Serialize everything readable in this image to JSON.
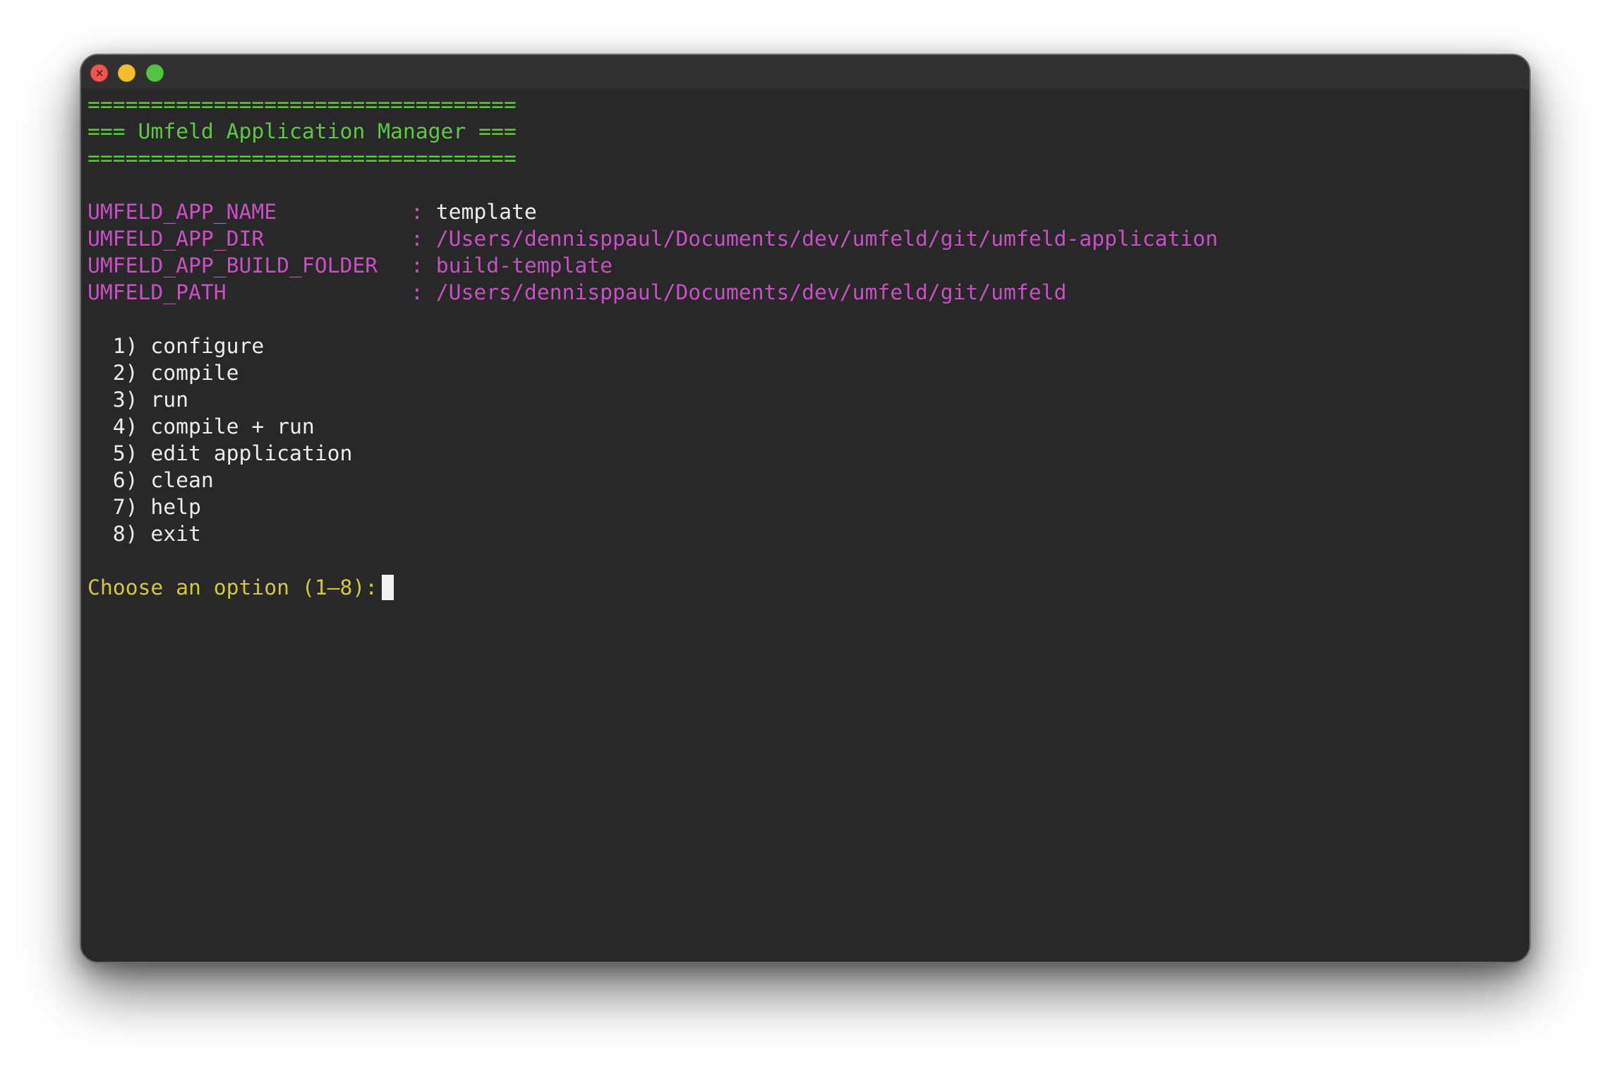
{
  "header": {
    "rule": "==================================",
    "title": "=== Umfeld Application Manager ==="
  },
  "env": [
    {
      "key": "UMFELD_APP_NAME",
      "sep": ": ",
      "value": "template"
    },
    {
      "key": "UMFELD_APP_DIR",
      "sep": ": ",
      "value": "/Users/dennisppaul/Documents/dev/umfeld/git/umfeld-application"
    },
    {
      "key": "UMFELD_APP_BUILD_FOLDER",
      "sep": ": ",
      "value": "build-template"
    },
    {
      "key": "UMFELD_PATH",
      "sep": ": ",
      "value": "/Users/dennisppaul/Documents/dev/umfeld/git/umfeld"
    }
  ],
  "menu": [
    "  1) configure",
    "  2) compile",
    "  3) run",
    "  4) compile + run",
    "  5) edit application",
    "  6) clean",
    "  7) help",
    "  8) exit"
  ],
  "prompt": "Choose an option (1–8):",
  "colors": {
    "background": "#282828",
    "green": "#5fc742",
    "magenta": "#c84fc4",
    "yellow": "#d1c93b",
    "text": "#ececec"
  }
}
